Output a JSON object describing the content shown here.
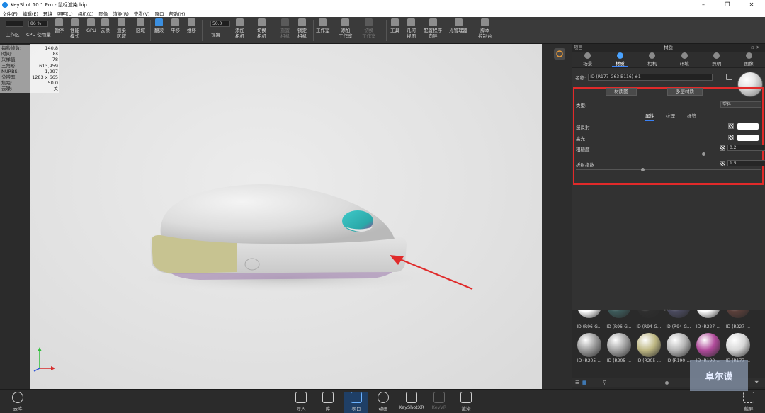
{
  "window": {
    "title": "KeyShot 10.1 Pro - 鼠标渲染.bip"
  },
  "menu": [
    "文件(F)",
    "编辑(E)",
    "环境",
    "照明(L)",
    "相机(C)",
    "图像",
    "渲染(R)",
    "查看(V)",
    "窗口",
    "帮助(H)"
  ],
  "toolbar": {
    "workspace_label": "工作区",
    "cpu_value": "86 %",
    "cpu_label": "CPU 使用量",
    "pause": "暂停",
    "perf_mode": "性能\n模式",
    "gpu": "GPU",
    "denoise": "去噪",
    "render_region": "渲染\n区域",
    "region": "区域",
    "tumble": "翻滚",
    "pan": "平移",
    "dolly": "推移",
    "fov_value": "50.0",
    "fov_label": "视角",
    "add_camera": "添加\n相机",
    "switch_camera": "切换\n相机",
    "reset_camera": "重置\n相机",
    "lock_camera": "锁定\n相机",
    "studio": "工作室",
    "add_studio": "添加\n工作室",
    "switch_studio": "切换\n工作室",
    "tools": "工具",
    "geometry_view": "几何\n视图",
    "config_wizard": "配置程序\n向导",
    "light_manager": "光管理器",
    "script_console": "脚本\n控制台"
  },
  "stats": [
    {
      "k": "每秒帧数:",
      "v": "140.8"
    },
    {
      "k": "时间:",
      "v": "8s"
    },
    {
      "k": "采样值:",
      "v": "78"
    },
    {
      "k": "三角形:",
      "v": "613,959"
    },
    {
      "k": "NURBS:",
      "v": "1,997"
    },
    {
      "k": "分辨率:",
      "v": "1283 x 665"
    },
    {
      "k": "焦距:",
      "v": "50.0"
    },
    {
      "k": "去噪:",
      "v": "关"
    }
  ],
  "panel": {
    "left_label": "项目",
    "title": "材质",
    "tabs": [
      "场景",
      "材质",
      "相机",
      "环境",
      "照明",
      "图像"
    ],
    "active_tab": "材质",
    "name_label": "名称:",
    "name_value": "ID (R177-G63-B116) #1",
    "material_graph": "材质图",
    "multi_material": "多层材质",
    "type_label": "类型:",
    "type_value": "塑料",
    "subtabs": [
      "属性",
      "纹理",
      "标签"
    ],
    "active_subtab": "属性",
    "props": {
      "diffuse": "漫反射",
      "specular": "高光",
      "roughness": "粗糙度",
      "roughness_value": "0.2",
      "roughness_level": 0.2,
      "ior": "折射指数",
      "ior_value": "1.5",
      "ior_level": 0.35
    },
    "diffuse_color": "#ffffff",
    "specular_color": "#ffffff"
  },
  "library": {
    "row1": [
      "ID (R96-G...",
      "ID (R96-G...",
      "ID (R94-G...",
      "ID (R94-G...",
      "ID (R227-...",
      "ID (R227-..."
    ],
    "row2": [
      "ID (R205-...",
      "ID (R205-...",
      "ID (R205-...",
      "ID (R190-...",
      "ID (R190-...",
      "ID (R177-..."
    ],
    "row2_colors": [
      "#9a9a9a",
      "#a3a3a3",
      "#bdb682",
      "#b5b5b5",
      "#b04a9a",
      "#d6d6d6"
    ],
    "row1_colors": [
      "#ffffff",
      "#3d5a5a",
      "#2e2e2e",
      "#4a4a5e",
      "#ffffff",
      "#5a3f3a"
    ]
  },
  "bottom": {
    "cloud": "云库",
    "import": "导入",
    "library": "库",
    "project": "项目",
    "animation": "动画",
    "keyshotxr": "KeyShotXR",
    "keyvr": "KeyVR",
    "render": "渲染",
    "screenshot": "截屏"
  },
  "watermark": "阜尔谟"
}
